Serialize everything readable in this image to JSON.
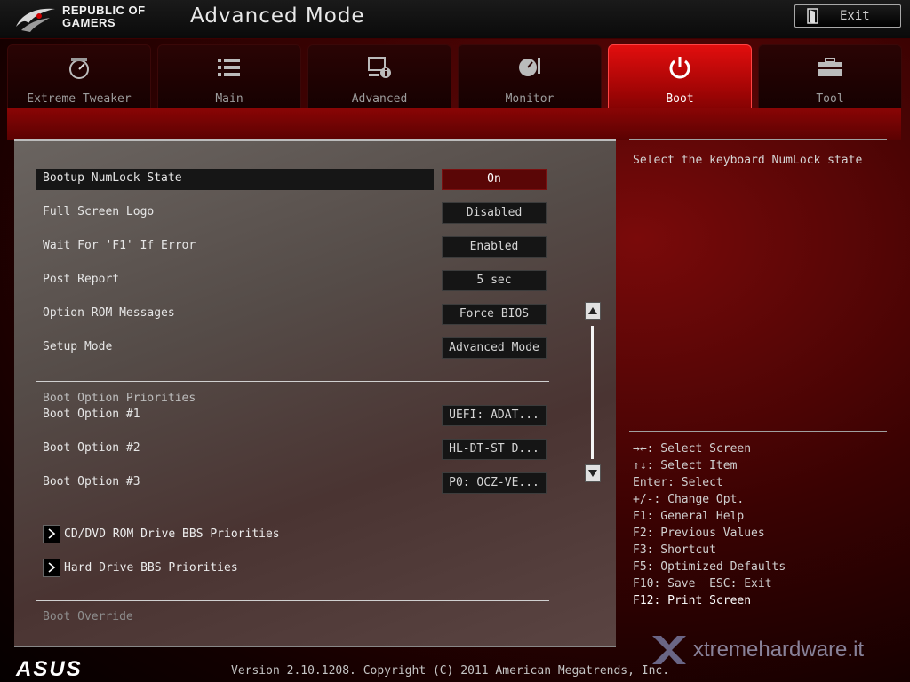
{
  "header": {
    "brand_line1": "REPUBLIC OF",
    "brand_line2": "GAMERS",
    "title": "Advanced Mode",
    "exit_label": "Exit"
  },
  "tabs": [
    {
      "label": "Extreme Tweaker",
      "icon": "speedometer-icon",
      "active": false
    },
    {
      "label": "Main",
      "icon": "list-icon",
      "active": false
    },
    {
      "label": "Advanced",
      "icon": "advanced-info-icon",
      "active": false
    },
    {
      "label": "Monitor",
      "icon": "gauge-icon",
      "active": false
    },
    {
      "label": "Boot",
      "icon": "power-icon",
      "active": true
    },
    {
      "label": "Tool",
      "icon": "toolbox-icon",
      "active": false
    }
  ],
  "settings": [
    {
      "label": "Bootup NumLock State",
      "value": "On",
      "selected": true
    },
    {
      "label": "Full Screen Logo",
      "value": "Disabled"
    },
    {
      "label": "Wait For 'F1' If Error",
      "value": "Enabled"
    },
    {
      "label": "Post Report",
      "value": "5 sec"
    },
    {
      "label": "Option ROM Messages",
      "value": "Force BIOS"
    },
    {
      "label": "Setup Mode",
      "value": "Advanced Mode"
    }
  ],
  "boot_priorities": {
    "heading": "Boot Option Priorities",
    "options": [
      {
        "label": "Boot Option #1",
        "value": "UEFI: ADAT..."
      },
      {
        "label": "Boot Option #2",
        "value": "HL-DT-ST D..."
      },
      {
        "label": "Boot Option #3",
        "value": "P0: OCZ-VE..."
      }
    ]
  },
  "submenus": [
    {
      "label": "CD/DVD ROM Drive BBS Priorities"
    },
    {
      "label": "Hard Drive BBS Priorities"
    }
  ],
  "boot_override_label": "Boot Override",
  "help": {
    "description": "Select the keyboard NumLock state",
    "keys": [
      "→←: Select Screen",
      "↑↓: Select Item",
      "Enter: Select",
      "+/-: Change Opt.",
      "F1: General Help",
      "F2: Previous Values",
      "F3: Shortcut",
      "F5: Optimized Defaults",
      "F10: Save  ESC: Exit",
      "F12: Print Screen"
    ]
  },
  "footer": {
    "asus_logo": "ASUS",
    "version": "Version 2.10.1208. Copyright (C) 2011 American Megatrends, Inc.",
    "watermark": "xtremehardware.it"
  }
}
